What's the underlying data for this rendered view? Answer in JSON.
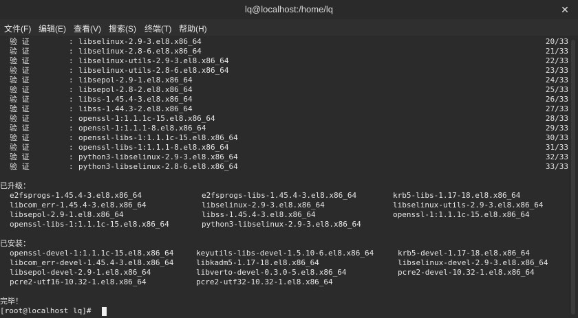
{
  "window": {
    "title": "lq@localhost:/home/lq",
    "close_glyph": "✕"
  },
  "menu": [
    {
      "label": "文件(F)"
    },
    {
      "label": "编辑(E)"
    },
    {
      "label": "查看(V)"
    },
    {
      "label": "搜索(S)"
    },
    {
      "label": "终端(T)"
    },
    {
      "label": "帮助(H)"
    }
  ],
  "verify": {
    "label": "验 证",
    "colon": ":",
    "rows": [
      {
        "pkg": "libselinux-2.9-3.el8.x86_64",
        "count": "20/33"
      },
      {
        "pkg": "libselinux-2.8-6.el8.x86_64",
        "count": "21/33"
      },
      {
        "pkg": "libselinux-utils-2.9-3.el8.x86_64",
        "count": "22/33"
      },
      {
        "pkg": "libselinux-utils-2.8-6.el8.x86_64",
        "count": "23/33"
      },
      {
        "pkg": "libsepol-2.9-1.el8.x86_64",
        "count": "24/33"
      },
      {
        "pkg": "libsepol-2.8-2.el8.x86_64",
        "count": "25/33"
      },
      {
        "pkg": "libss-1.45.4-3.el8.x86_64",
        "count": "26/33"
      },
      {
        "pkg": "libss-1.44.3-2.el8.x86_64",
        "count": "27/33"
      },
      {
        "pkg": "openssl-1:1.1.1c-15.el8.x86_64",
        "count": "28/33"
      },
      {
        "pkg": "openssl-1:1.1.1-8.el8.x86_64",
        "count": "29/33"
      },
      {
        "pkg": "openssl-libs-1:1.1.1c-15.el8.x86_64",
        "count": "30/33"
      },
      {
        "pkg": "openssl-libs-1:1.1.1-8.el8.x86_64",
        "count": "31/33"
      },
      {
        "pkg": "python3-libselinux-2.9-3.el8.x86_64",
        "count": "32/33"
      },
      {
        "pkg": "python3-libselinux-2.8-6.el8.x86_64",
        "count": "33/33"
      }
    ]
  },
  "upgraded": {
    "heading": "已升级：",
    "rows": [
      [
        "e2fsprogs-1.45.4-3.el8.x86_64",
        "e2fsprogs-libs-1.45.4-3.el8.x86_64",
        "krb5-libs-1.17-18.el8.x86_64"
      ],
      [
        "libcom_err-1.45.4-3.el8.x86_64",
        "libselinux-2.9-3.el8.x86_64",
        "libselinux-utils-2.9-3.el8.x86_64"
      ],
      [
        "libsepol-2.9-1.el8.x86_64",
        "libss-1.45.4-3.el8.x86_64",
        "openssl-1:1.1.1c-15.el8.x86_64"
      ],
      [
        "openssl-libs-1:1.1.1c-15.el8.x86_64",
        "python3-libselinux-2.9-3.el8.x86_64",
        ""
      ]
    ]
  },
  "installed": {
    "heading": "已安装：",
    "rows": [
      [
        "openssl-devel-1:1.1.1c-15.el8.x86_64",
        "keyutils-libs-devel-1.5.10-6.el8.x86_64",
        "krb5-devel-1.17-18.el8.x86_64"
      ],
      [
        "libcom_err-devel-1.45.4-3.el8.x86_64",
        "libkadm5-1.17-18.el8.x86_64",
        "libselinux-devel-2.9-3.el8.x86_64"
      ],
      [
        "libsepol-devel-2.9-1.el8.x86_64",
        "libverto-devel-0.3.0-5.el8.x86_64",
        "pcre2-devel-10.32-1.el8.x86_64"
      ],
      [
        "pcre2-utf16-10.32-1.el8.x86_64",
        "pcre2-utf32-10.32-1.el8.x86_64",
        ""
      ]
    ]
  },
  "done": "完毕！",
  "prompt": "[root@localhost lq]# "
}
